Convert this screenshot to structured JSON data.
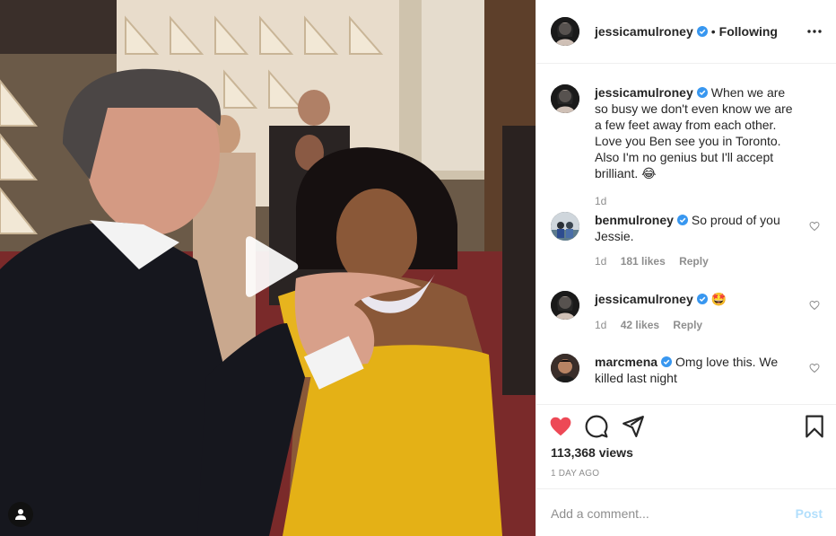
{
  "post": {
    "author": "jessicamulroney",
    "follow_separator": "•",
    "follow_status": "Following",
    "caption": {
      "username": "jessicamulroney",
      "text": "When we are so busy we don't even know we are a few feet away from each other. Love you Ben see you in Toronto. Also I'm no genius but I'll accept brilliant. 😂",
      "age": "1d"
    },
    "views": "113,368 views",
    "posted": "1 day ago"
  },
  "comments": [
    {
      "username": "benmulroney",
      "text": "So proud of you Jessie.",
      "age": "1d",
      "likes": "181 likes",
      "reply": "Reply"
    },
    {
      "username": "jessicamulroney",
      "text": "🤩",
      "age": "1d",
      "likes": "42 likes",
      "reply": "Reply"
    },
    {
      "username": "marcmena",
      "text": "Omg love this. We killed last night"
    }
  ],
  "composer": {
    "placeholder": "Add a comment...",
    "post_label": "Post"
  },
  "icons": {
    "verified": "verified-badge-icon",
    "more": "more-options-icon",
    "like": "heart-icon",
    "comment": "comment-bubble-icon",
    "share": "paper-plane-icon",
    "save": "bookmark-icon",
    "play": "play-icon",
    "tags": "user-tag-icon"
  },
  "colors": {
    "liked_heart": "#ed4956",
    "verified_blue": "#3897f0",
    "post_disabled": "#b2dffc",
    "muted_text": "#8e8e8e"
  }
}
